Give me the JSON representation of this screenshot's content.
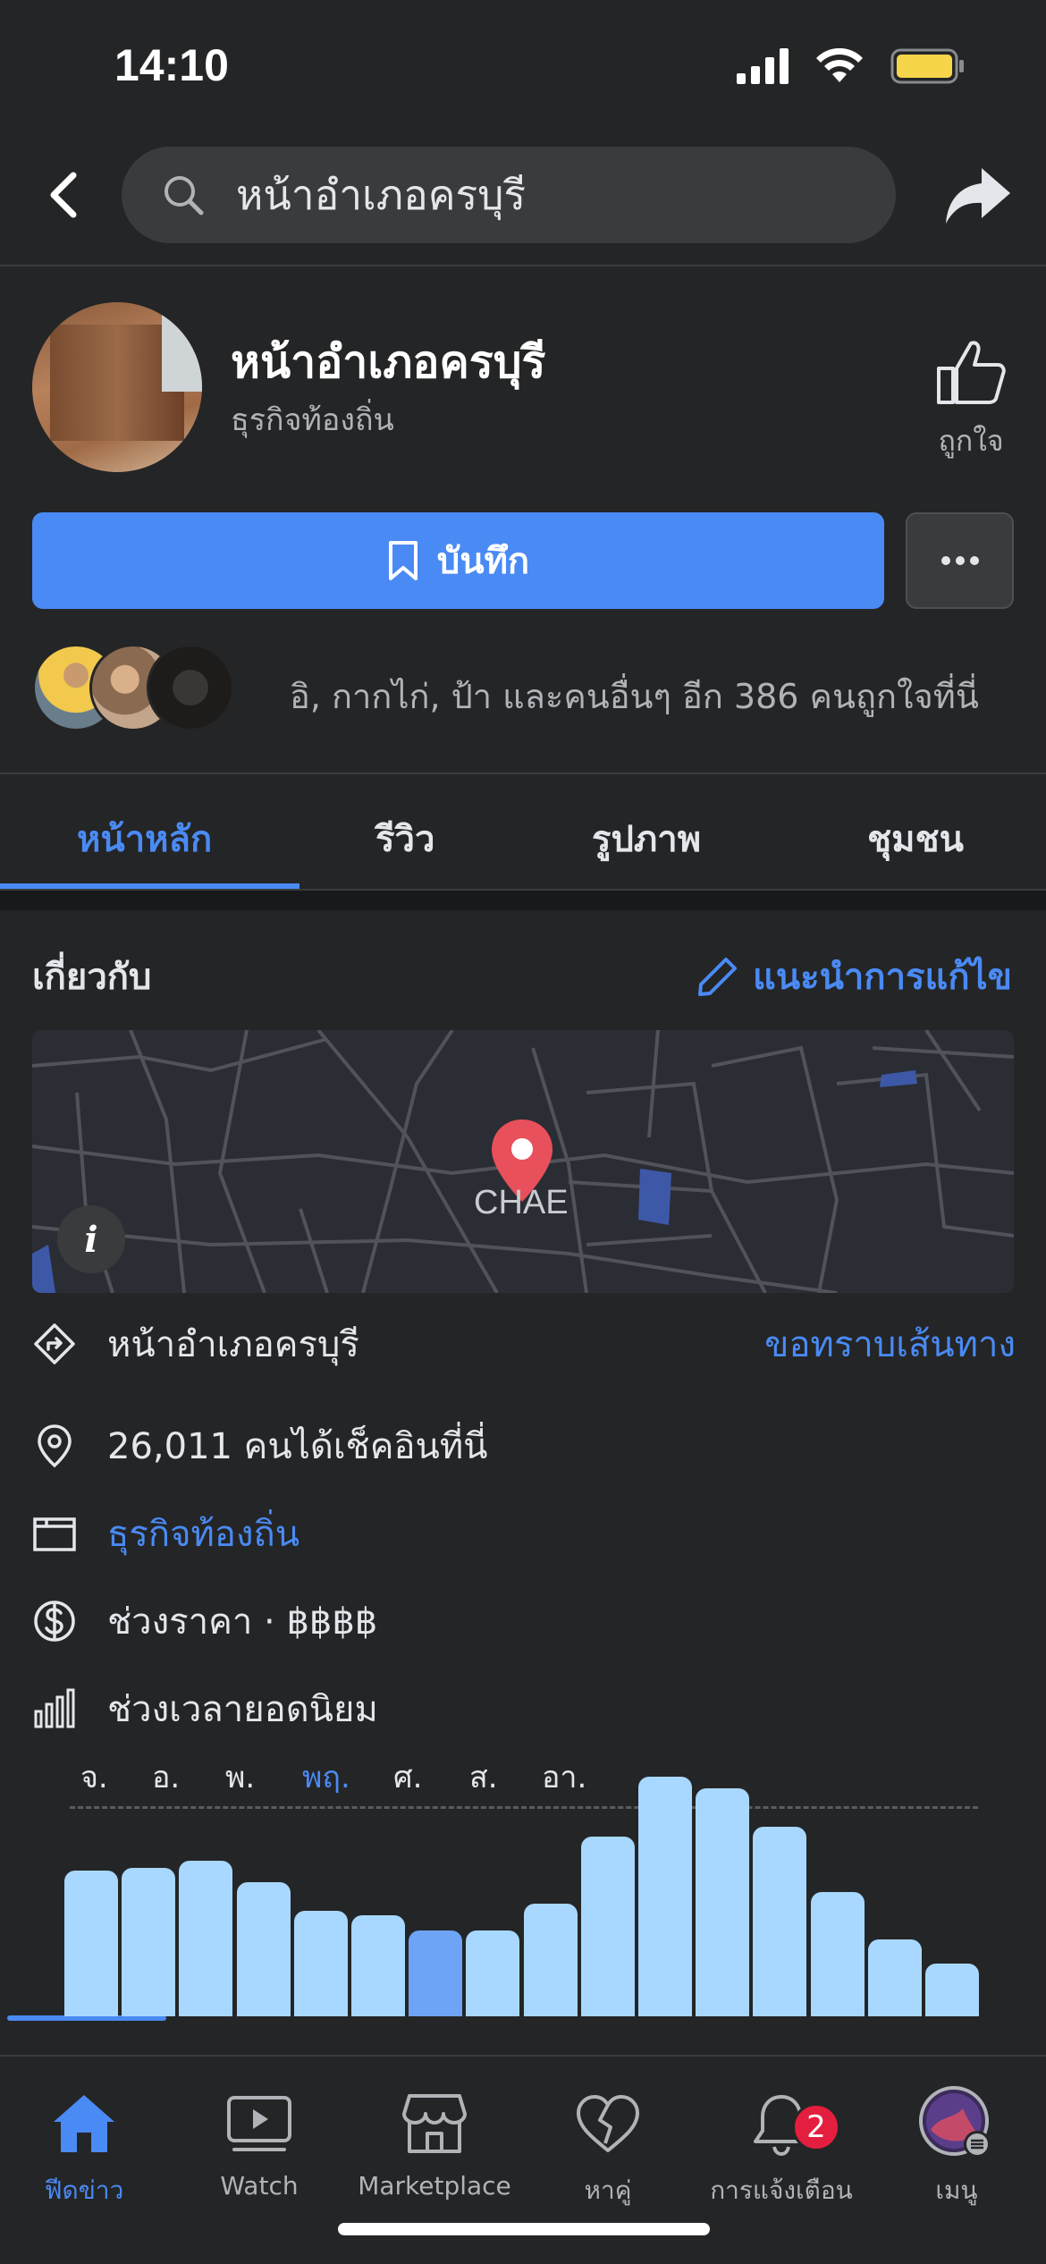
{
  "status_bar": {
    "time": "14:10"
  },
  "nav": {
    "search_text": "หน้าอำเภอครบุรี"
  },
  "profile": {
    "name": "หน้าอำเภอครบุรี",
    "category": "ธุรกิจท้องถิ่น",
    "like_label": "ถูกใจ"
  },
  "actions": {
    "save_label": "บันทึก"
  },
  "friends": {
    "text": "อิ, กากไก่, ป้า และคนอื่นๆ อีก 386 คนถูกใจที่นี่"
  },
  "tabs": [
    {
      "label": "หน้าหลัก",
      "active": true
    },
    {
      "label": "รีวิว",
      "active": false
    },
    {
      "label": "รูปภาพ",
      "active": false
    },
    {
      "label": "ชุมชน",
      "active": false
    }
  ],
  "about": {
    "title": "เกี่ยวกับ",
    "suggest_edit": "แนะนำการแก้ไข",
    "map_label": "CHAE",
    "map_info": "i",
    "address": "หน้าอำเภอครบุรี",
    "directions": "ขอทราบเส้นทาง",
    "checkins": "26,011 คนได้เช็คอินที่นี่",
    "category_link": "ธุรกิจท้องถิ่น",
    "price_range": "ช่วงราคา · ฿฿฿฿",
    "popular_times": "ช่วงเวลายอดนิยม"
  },
  "chart_data": {
    "type": "bar",
    "days": [
      "จ.",
      "อ.",
      "พ.",
      "พฤ.",
      "ศ.",
      "ส.",
      "อา."
    ],
    "selected_day": "พฤ.",
    "values": [
      61,
      62,
      65,
      56,
      44,
      42,
      36,
      36,
      47,
      75,
      100,
      95,
      79,
      52,
      32,
      22
    ],
    "current_index": 6,
    "colors": {
      "bar": "#a8d8ff",
      "current": "#6ea4f5"
    }
  },
  "tab_bar": {
    "items": [
      {
        "label": "ฟีดข่าว",
        "icon": "home-icon",
        "active": true
      },
      {
        "label": "Watch",
        "icon": "watch-icon",
        "active": false
      },
      {
        "label": "Marketplace",
        "icon": "marketplace-icon",
        "active": false
      },
      {
        "label": "หาคู่",
        "icon": "dating-icon",
        "active": false
      },
      {
        "label": "การแจ้งเตือน",
        "icon": "bell-icon",
        "active": false,
        "badge": "2"
      },
      {
        "label": "เมนู",
        "icon": "menu-avatar-icon",
        "active": false
      }
    ]
  },
  "colors": {
    "accent": "#4a8af4",
    "background": "#242526",
    "surface": "#3a3b3c",
    "badge": "#e41e3f"
  }
}
